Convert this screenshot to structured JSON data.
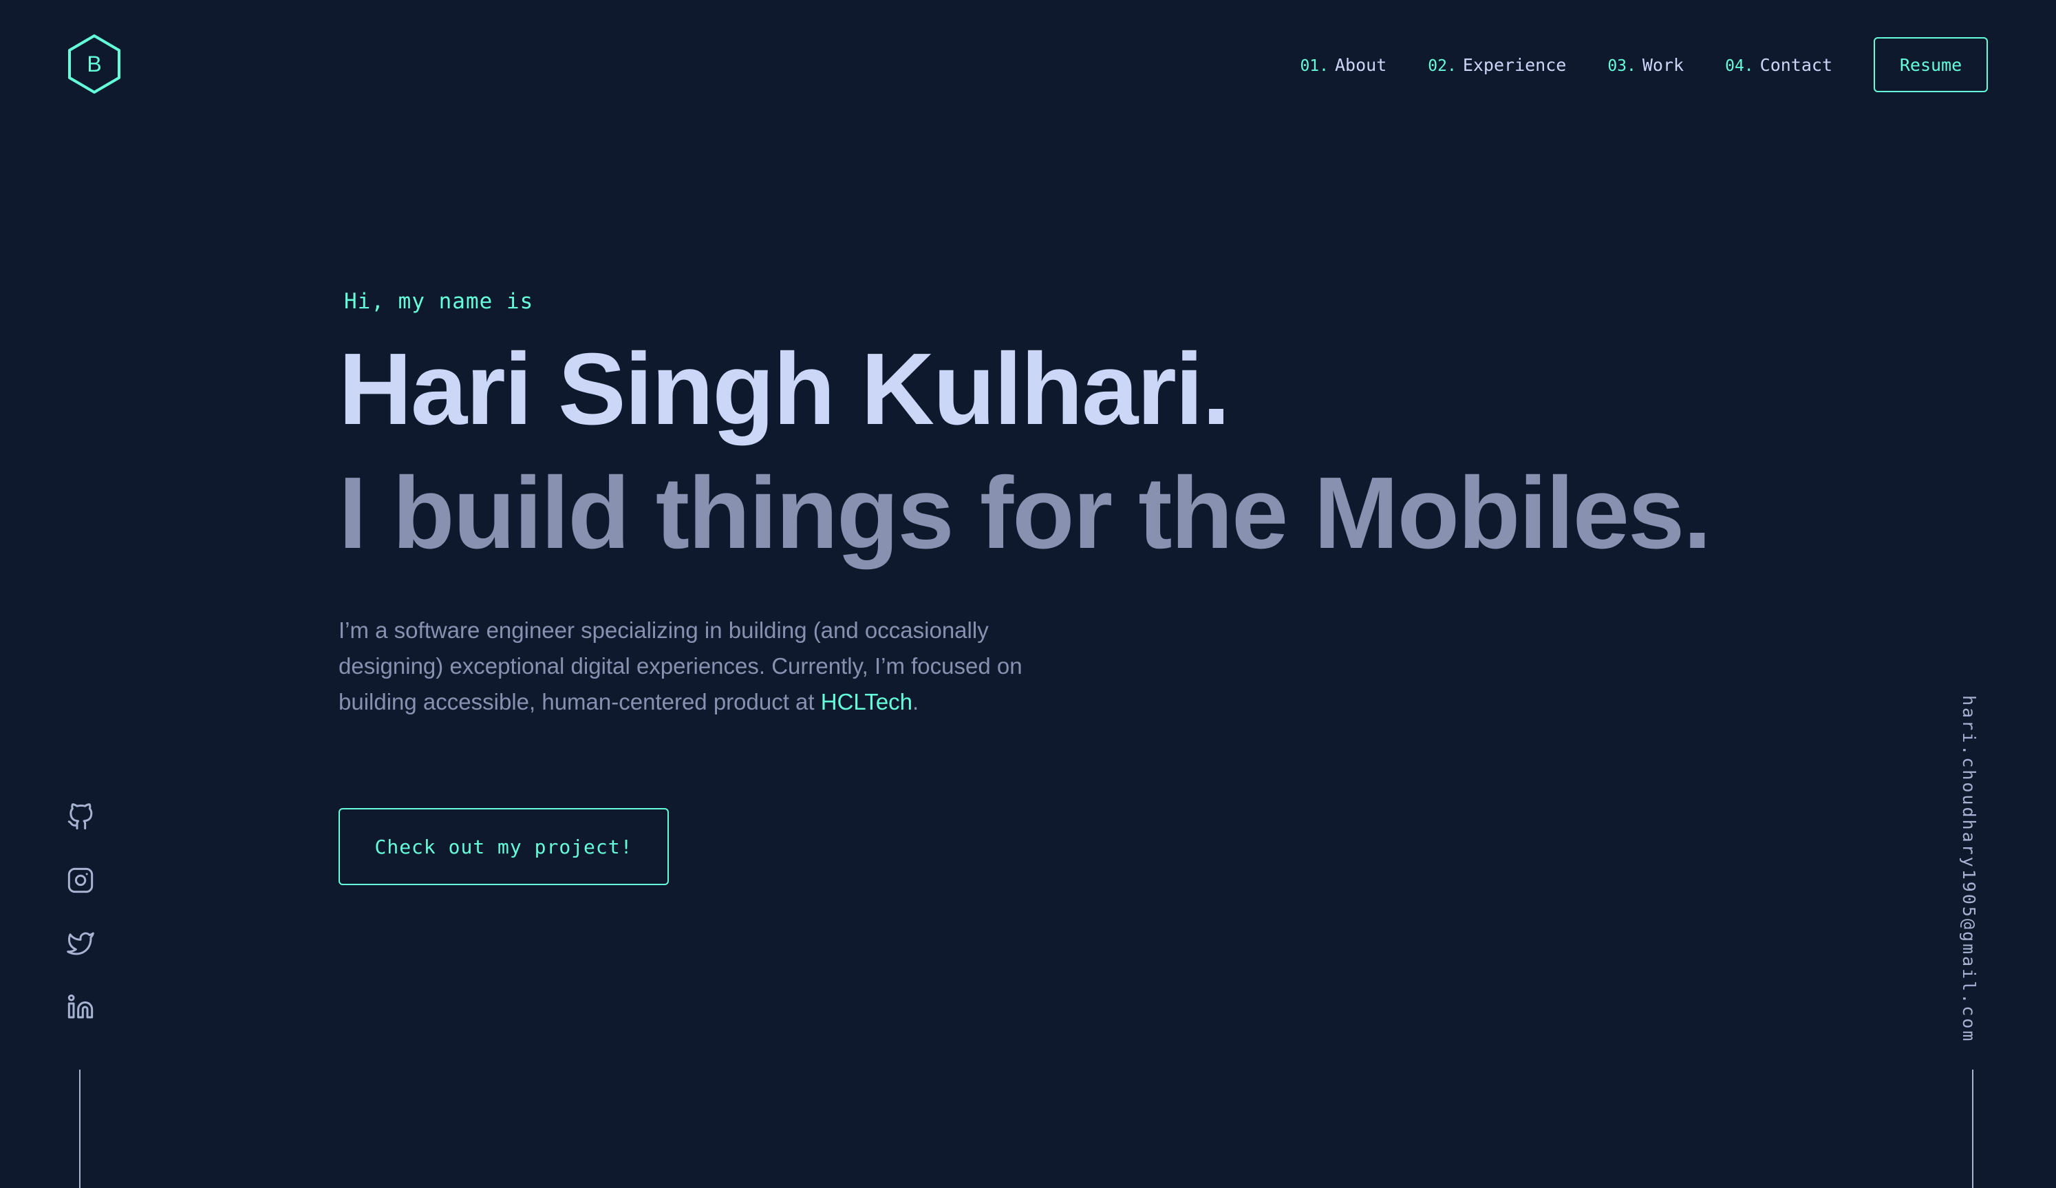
{
  "header": {
    "logo_letter": "B",
    "nav": [
      {
        "num": "01.",
        "label": "About"
      },
      {
        "num": "02.",
        "label": "Experience"
      },
      {
        "num": "03.",
        "label": "Work"
      },
      {
        "num": "04.",
        "label": "Contact"
      }
    ],
    "resume_label": "Resume"
  },
  "hero": {
    "greeting": "Hi, my name is",
    "name": "Hari Singh Kulhari.",
    "tagline": "I build things for the Mobiles.",
    "bio_text": "I’m a software engineer specializing in building (and occasionally designing) exceptional digital experiences. Currently, I’m focused on building accessible, human-centered product at ",
    "bio_link": "HCLTech",
    "bio_end": ".",
    "cta_label": "Check out my project!"
  },
  "socials": [
    "github-icon",
    "instagram-icon",
    "twitter-icon",
    "linkedin-icon"
  ],
  "email": "hari.choudhary1905@gmail.com",
  "colors": {
    "background": "#0e192d",
    "accent": "#64ffda",
    "heading": "#ccd6f6",
    "body": "#8892b0"
  }
}
